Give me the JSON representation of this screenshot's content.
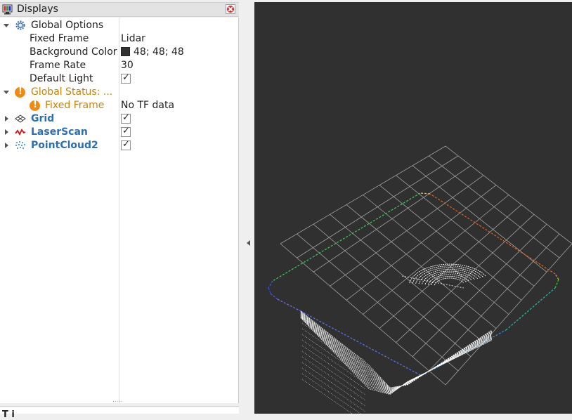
{
  "displays_panel": {
    "title": "Displays",
    "icons": {
      "header": "monitor-icon",
      "close": "close-icon"
    }
  },
  "tree": {
    "global_options": {
      "label": "Global Options",
      "icon": "gear-icon",
      "fixed_frame": {
        "label": "Fixed Frame",
        "value": "Lidar"
      },
      "background_color": {
        "label": "Background Color",
        "value": "48; 48; 48",
        "color": "#303030"
      },
      "frame_rate": {
        "label": "Frame Rate",
        "value": "30"
      },
      "default_light": {
        "label": "Default Light",
        "checked": true
      }
    },
    "global_status": {
      "label": "Global Status: ...",
      "icon": "warning-icon",
      "color": "#c8830a",
      "fixed_frame": {
        "label": "Fixed Frame",
        "value": "No TF data"
      }
    },
    "plugins": [
      {
        "label": "Grid",
        "icon": "grid-icon",
        "checked": true
      },
      {
        "label": "LaserScan",
        "icon": "laserscan-icon",
        "checked": true
      },
      {
        "label": "PointCloud2",
        "icon": "pointcloud-icon",
        "checked": true
      }
    ]
  },
  "bottom_panel": {
    "partial_title": "T i"
  },
  "viewport": {
    "background": "#303030",
    "grid_color": "#a0a0a0",
    "scan_color": "#ffffff"
  }
}
